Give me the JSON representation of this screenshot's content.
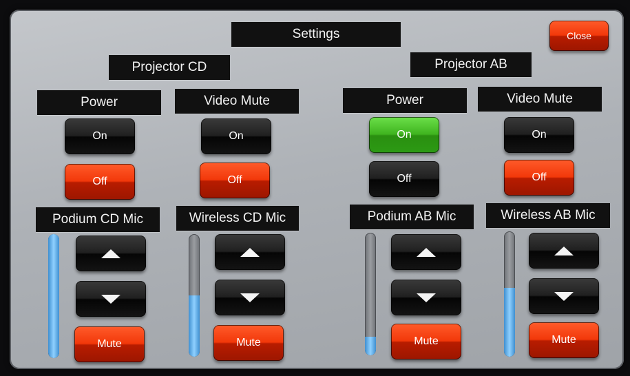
{
  "title": "Settings",
  "close_label": "Close",
  "groups": [
    {
      "name": "Projector CD",
      "power": {
        "label": "Power",
        "on": "On",
        "off": "Off",
        "state": "off"
      },
      "video_mute": {
        "label": "Video Mute",
        "on": "On",
        "off": "Off",
        "state": "off"
      }
    },
    {
      "name": "Projector AB",
      "power": {
        "label": "Power",
        "on": "On",
        "off": "Off",
        "state": "on"
      },
      "video_mute": {
        "label": "Video Mute",
        "on": "On",
        "off": "Off",
        "state": "off"
      }
    }
  ],
  "mics": [
    {
      "label": "Podium CD Mic",
      "mute": "Mute",
      "level": 1.0
    },
    {
      "label": "Wireless CD Mic",
      "mute": "Mute",
      "level": 0.5
    },
    {
      "label": "Podium AB Mic",
      "mute": "Mute",
      "level": 0.15
    },
    {
      "label": "Wireless AB Mic",
      "mute": "Mute",
      "level": 0.55
    }
  ],
  "colors": {
    "active_green": "#3fb41f",
    "alert_red": "#f2380a",
    "label_bg": "#111111"
  }
}
